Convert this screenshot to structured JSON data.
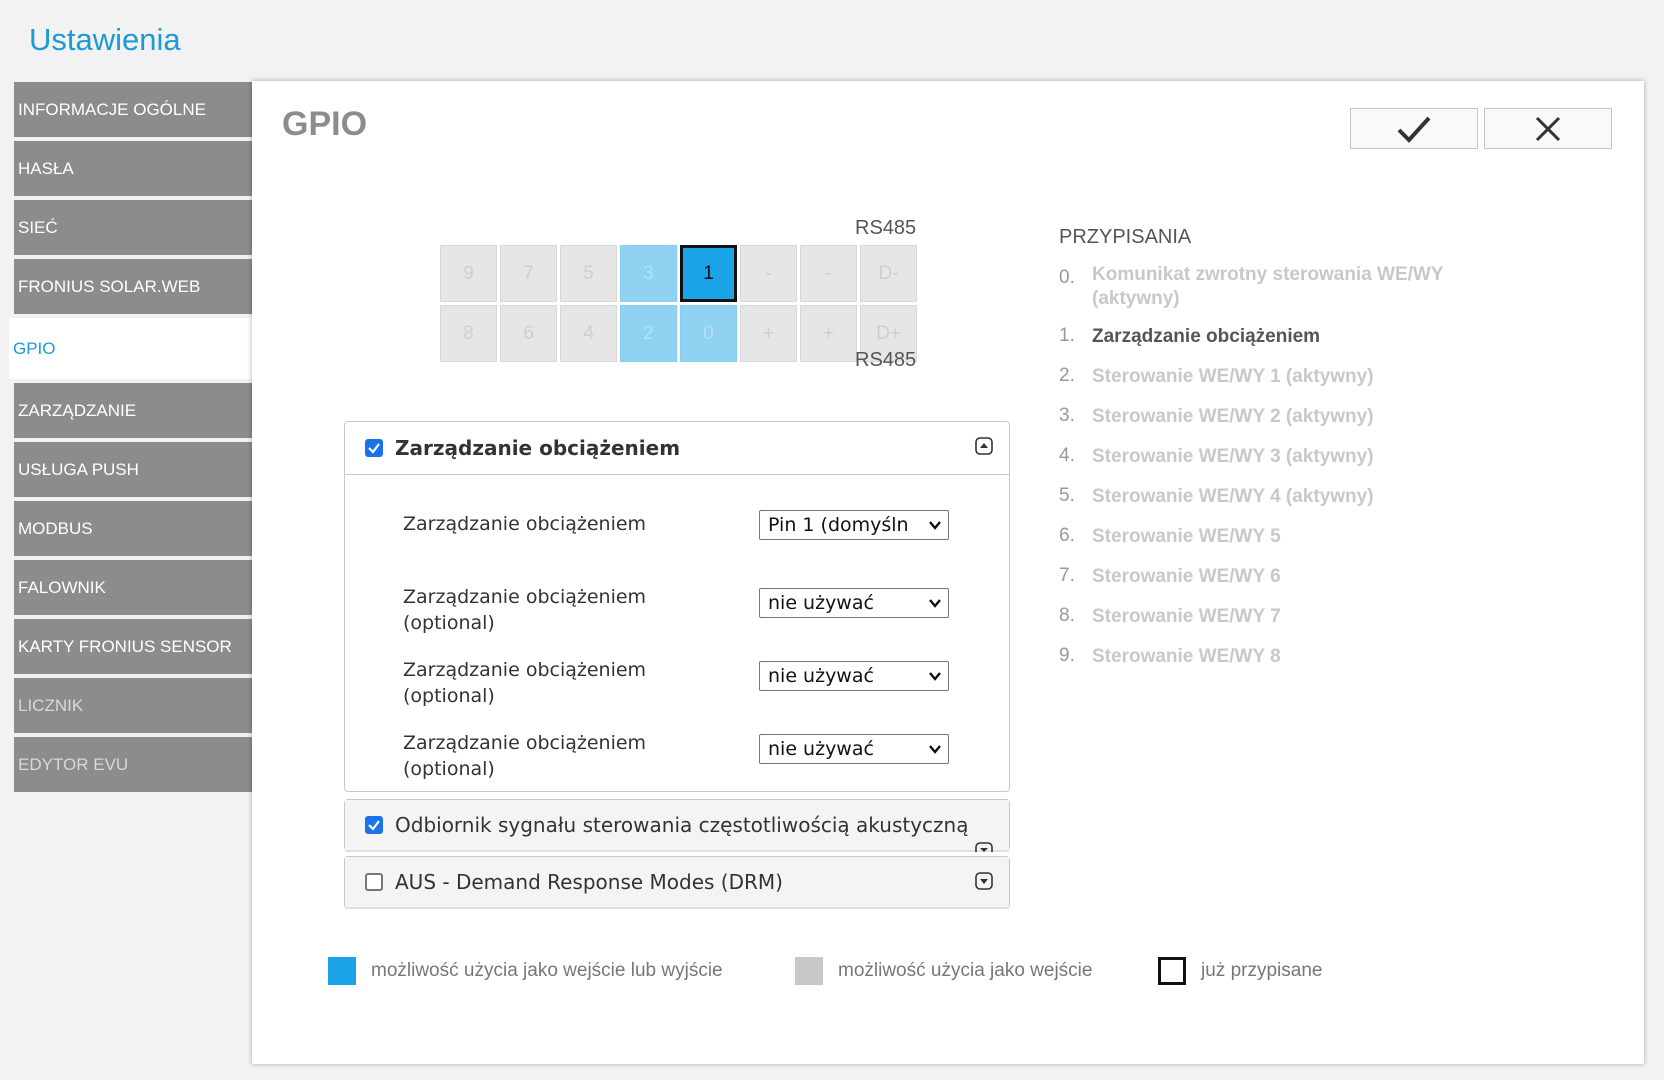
{
  "app": {
    "title": "Ustawienia"
  },
  "sidebar": {
    "items": [
      {
        "label": "INFORMACJE OGÓLNE"
      },
      {
        "label": "HASŁA"
      },
      {
        "label": "SIEĆ"
      },
      {
        "label": "FRONIUS SOLAR.WEB"
      },
      {
        "label": "GPIO"
      },
      {
        "label": "ZARZĄDZANIE"
      },
      {
        "label": "USŁUGA PUSH"
      },
      {
        "label": "MODBUS"
      },
      {
        "label": "FALOWNIK"
      },
      {
        "label": "KARTY FRONIUS SENSOR"
      },
      {
        "label": "LICZNIK"
      },
      {
        "label": "EDYTOR EVU"
      }
    ],
    "active": "GPIO"
  },
  "page": {
    "title": "GPIO"
  },
  "connector": {
    "top_label": "RS485",
    "bottom_label": "RS485",
    "top_row": [
      "9",
      "7",
      "5",
      "3",
      "1",
      "-",
      "-",
      "D-"
    ],
    "bottom_row": [
      "8",
      "6",
      "4",
      "2",
      "0",
      "+",
      "+",
      "D+"
    ],
    "selected_pin": "1"
  },
  "cards": {
    "load": {
      "title": "Zarządzanie obciążeniem",
      "rows": [
        {
          "label": "Zarządzanie obciążeniem",
          "value": "Pin 1 (domyśln"
        },
        {
          "label": "Zarządzanie obciążeniem",
          "label2": "(optional)",
          "value": "nie używać"
        },
        {
          "label": "Zarządzanie obciążeniem",
          "label2": "(optional)",
          "value": "nie używać"
        },
        {
          "label": "Zarządzanie obciążeniem",
          "label2": "(optional)",
          "value": "nie używać"
        }
      ]
    },
    "ripple": {
      "title": "Odbiornik sygnału sterowania częstotliwością akustyczną"
    },
    "drm": {
      "title": "AUS - Demand Response Modes (DRM)"
    }
  },
  "assignments": {
    "title": "PRZYPISANIA",
    "items": [
      {
        "num": "0.",
        "text": "Komunikat zwrotny sterowania WE/WY (aktywny)"
      },
      {
        "num": "1.",
        "text": "Zarządzanie obciążeniem"
      },
      {
        "num": "2.",
        "text": "Sterowanie WE/WY 1 (aktywny)"
      },
      {
        "num": "3.",
        "text": "Sterowanie WE/WY 2 (aktywny)"
      },
      {
        "num": "4.",
        "text": "Sterowanie WE/WY 3 (aktywny)"
      },
      {
        "num": "5.",
        "text": "Sterowanie WE/WY 4 (aktywny)"
      },
      {
        "num": "6.",
        "text": "Sterowanie WE/WY 5"
      },
      {
        "num": "7.",
        "text": "Sterowanie WE/WY 6"
      },
      {
        "num": "8.",
        "text": "Sterowanie WE/WY 7"
      },
      {
        "num": "9.",
        "text": "Sterowanie WE/WY 8"
      }
    ]
  },
  "legend": {
    "io": "możliwość użycia jako wejście lub wyjście",
    "input": "możliwość użycia jako wejście",
    "assigned": "już przypisane"
  },
  "colors": {
    "accent": "#1a9ad6",
    "pin_io": "#8fd2f2",
    "pin_selected": "#1aa3e6",
    "nav": "#8c8c8c"
  }
}
